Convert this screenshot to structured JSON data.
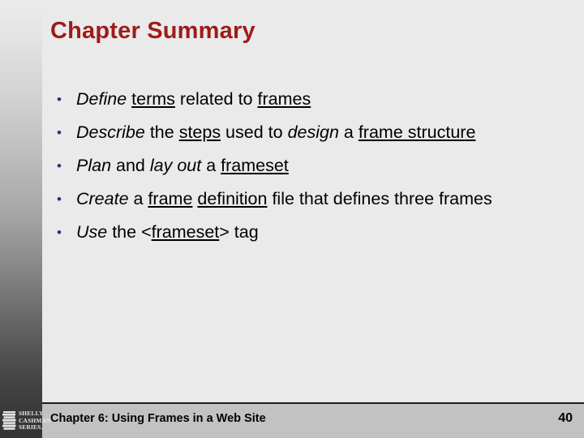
{
  "slide": {
    "title": "Chapter Summary",
    "title_color": "#9e1b1b",
    "background_color": "#eaeaea",
    "bullet_marker": "•",
    "bullet_color": "#1f3a6e"
  },
  "bullets": [
    {
      "plain": "Define terms related to frames",
      "runs": [
        {
          "text": "Define",
          "italic": true,
          "underline": false
        },
        {
          "text": " ",
          "italic": false,
          "underline": false
        },
        {
          "text": "terms",
          "italic": false,
          "underline": true
        },
        {
          "text": " related to ",
          "italic": false,
          "underline": false
        },
        {
          "text": "frames",
          "italic": false,
          "underline": true
        }
      ]
    },
    {
      "plain": "Describe the steps used to design a frame structure",
      "runs": [
        {
          "text": "Describe",
          "italic": true,
          "underline": false
        },
        {
          "text": " the ",
          "italic": false,
          "underline": false
        },
        {
          "text": "steps",
          "italic": false,
          "underline": true
        },
        {
          "text": " used to ",
          "italic": false,
          "underline": false
        },
        {
          "text": "design",
          "italic": true,
          "underline": false
        },
        {
          "text": " a ",
          "italic": false,
          "underline": false
        },
        {
          "text": "frame structure",
          "italic": false,
          "underline": true
        }
      ]
    },
    {
      "plain": "Plan and lay out a frameset",
      "runs": [
        {
          "text": "Plan",
          "italic": true,
          "underline": false
        },
        {
          "text": " and ",
          "italic": false,
          "underline": false
        },
        {
          "text": "lay out",
          "italic": true,
          "underline": false
        },
        {
          "text": " a ",
          "italic": false,
          "underline": false
        },
        {
          "text": "frameset",
          "italic": false,
          "underline": true
        }
      ]
    },
    {
      "plain": "Create a frame definition file that defines three frames",
      "runs": [
        {
          "text": "Create",
          "italic": true,
          "underline": false
        },
        {
          "text": " a ",
          "italic": false,
          "underline": false
        },
        {
          "text": "frame",
          "italic": false,
          "underline": true
        },
        {
          "text": " ",
          "italic": false,
          "underline": false
        },
        {
          "text": "definition",
          "italic": false,
          "underline": true
        },
        {
          "text": " file that defines three frames",
          "italic": false,
          "underline": false
        }
      ]
    },
    {
      "plain": "Use the <frameset> tag",
      "runs": [
        {
          "text": "Use",
          "italic": true,
          "underline": false
        },
        {
          "text": " the <",
          "italic": false,
          "underline": false
        },
        {
          "text": "frameset",
          "italic": false,
          "underline": true
        },
        {
          "text": "> tag",
          "italic": false,
          "underline": false
        }
      ]
    }
  ],
  "footer": {
    "title": "Chapter 6: Using Frames in a Web Site",
    "page_number": "40",
    "bar_color": "#c2c2c2"
  },
  "logo": {
    "line1": "SHELLY",
    "line2": "CASHMAN",
    "line3": "SERIES."
  }
}
